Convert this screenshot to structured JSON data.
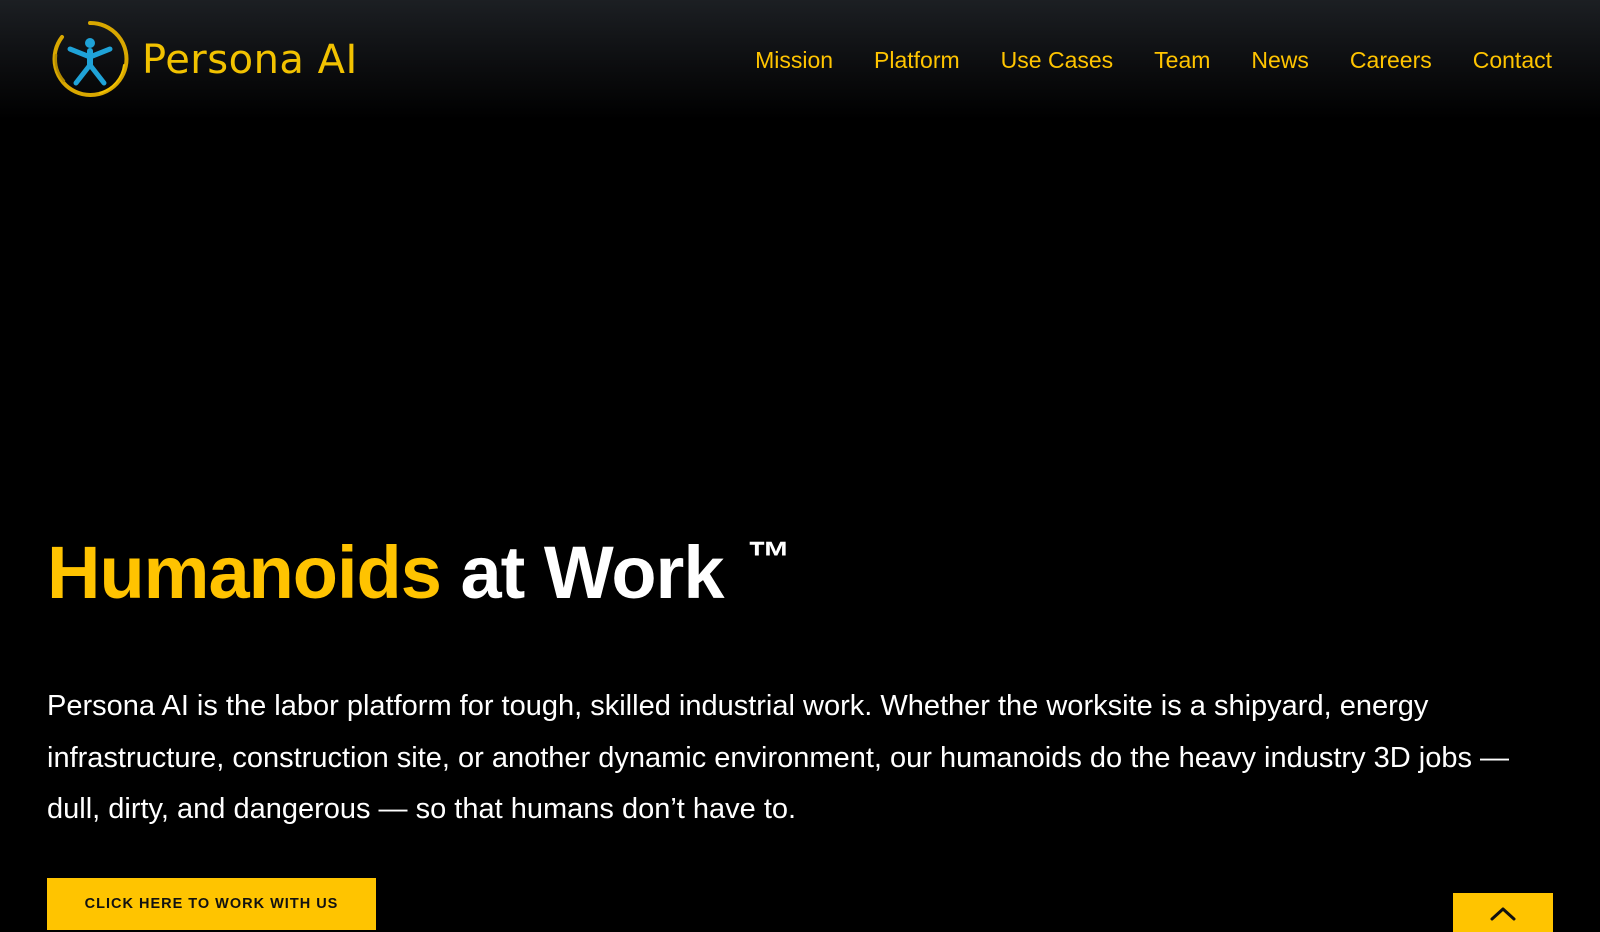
{
  "brand": {
    "name": "Persona AI",
    "logo_icon": "vitruvian-figure-ring-icon",
    "primary_color": "#ffc400",
    "logo_figure_color": "#1fa3d8",
    "background_color": "#000000"
  },
  "nav": {
    "items": [
      {
        "label": "Mission"
      },
      {
        "label": "Platform"
      },
      {
        "label": "Use Cases"
      },
      {
        "label": "Team"
      },
      {
        "label": "News"
      },
      {
        "label": "Careers"
      },
      {
        "label": "Contact"
      }
    ]
  },
  "hero": {
    "title_accent": "Humanoids",
    "title_rest": "at Work",
    "title_mark": "™",
    "description": "Persona AI is the labor platform for tough, skilled industrial work. Whether the worksite is a shipyard, energy infrastructure, construction site, or another dynamic environment, our humanoids do the heavy industry 3D jobs — dull, dirty, and dangerous — so that humans don’t have to.",
    "cta_label": "CLICK HERE TO WORK WITH US"
  },
  "scroll_top": {
    "icon": "chevron-up-icon"
  }
}
